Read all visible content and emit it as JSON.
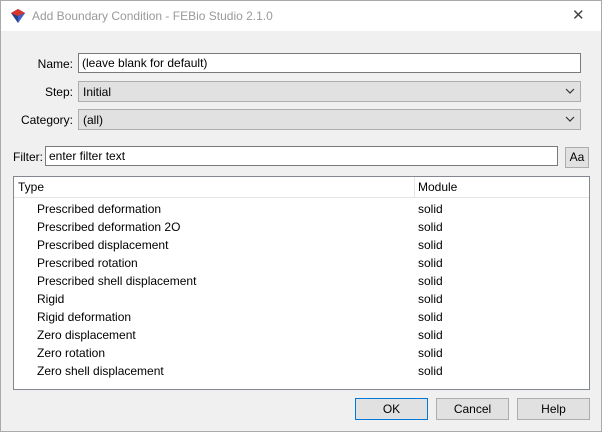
{
  "window": {
    "title": "Add Boundary Condition - FEBio Studio 2.1.0",
    "close_glyph": "✕"
  },
  "form": {
    "name_label": "Name:",
    "name_value": "(leave blank for default)",
    "step_label": "Step:",
    "step_value": "Initial",
    "category_label": "Category:",
    "category_value": "(all)",
    "filter_label": "Filter:",
    "filter_placeholder": "enter filter text",
    "case_button": "Aa"
  },
  "list": {
    "columns": [
      "Type",
      "Module"
    ],
    "rows": [
      {
        "type": "Prescribed deformation",
        "module": "solid"
      },
      {
        "type": "Prescribed deformation 2O",
        "module": "solid"
      },
      {
        "type": "Prescribed displacement",
        "module": "solid"
      },
      {
        "type": "Prescribed rotation",
        "module": "solid"
      },
      {
        "type": "Prescribed shell displacement",
        "module": "solid"
      },
      {
        "type": "Rigid",
        "module": "solid"
      },
      {
        "type": "Rigid deformation",
        "module": "solid"
      },
      {
        "type": "Zero displacement",
        "module": "solid"
      },
      {
        "type": "Zero rotation",
        "module": "solid"
      },
      {
        "type": "Zero shell displacement",
        "module": "solid"
      }
    ]
  },
  "buttons": {
    "ok": "OK",
    "cancel": "Cancel",
    "help": "Help"
  },
  "colors": {
    "titlebar": "#ffffff",
    "dialog_bg": "#f0f0f0",
    "accent": "#0078d7"
  }
}
